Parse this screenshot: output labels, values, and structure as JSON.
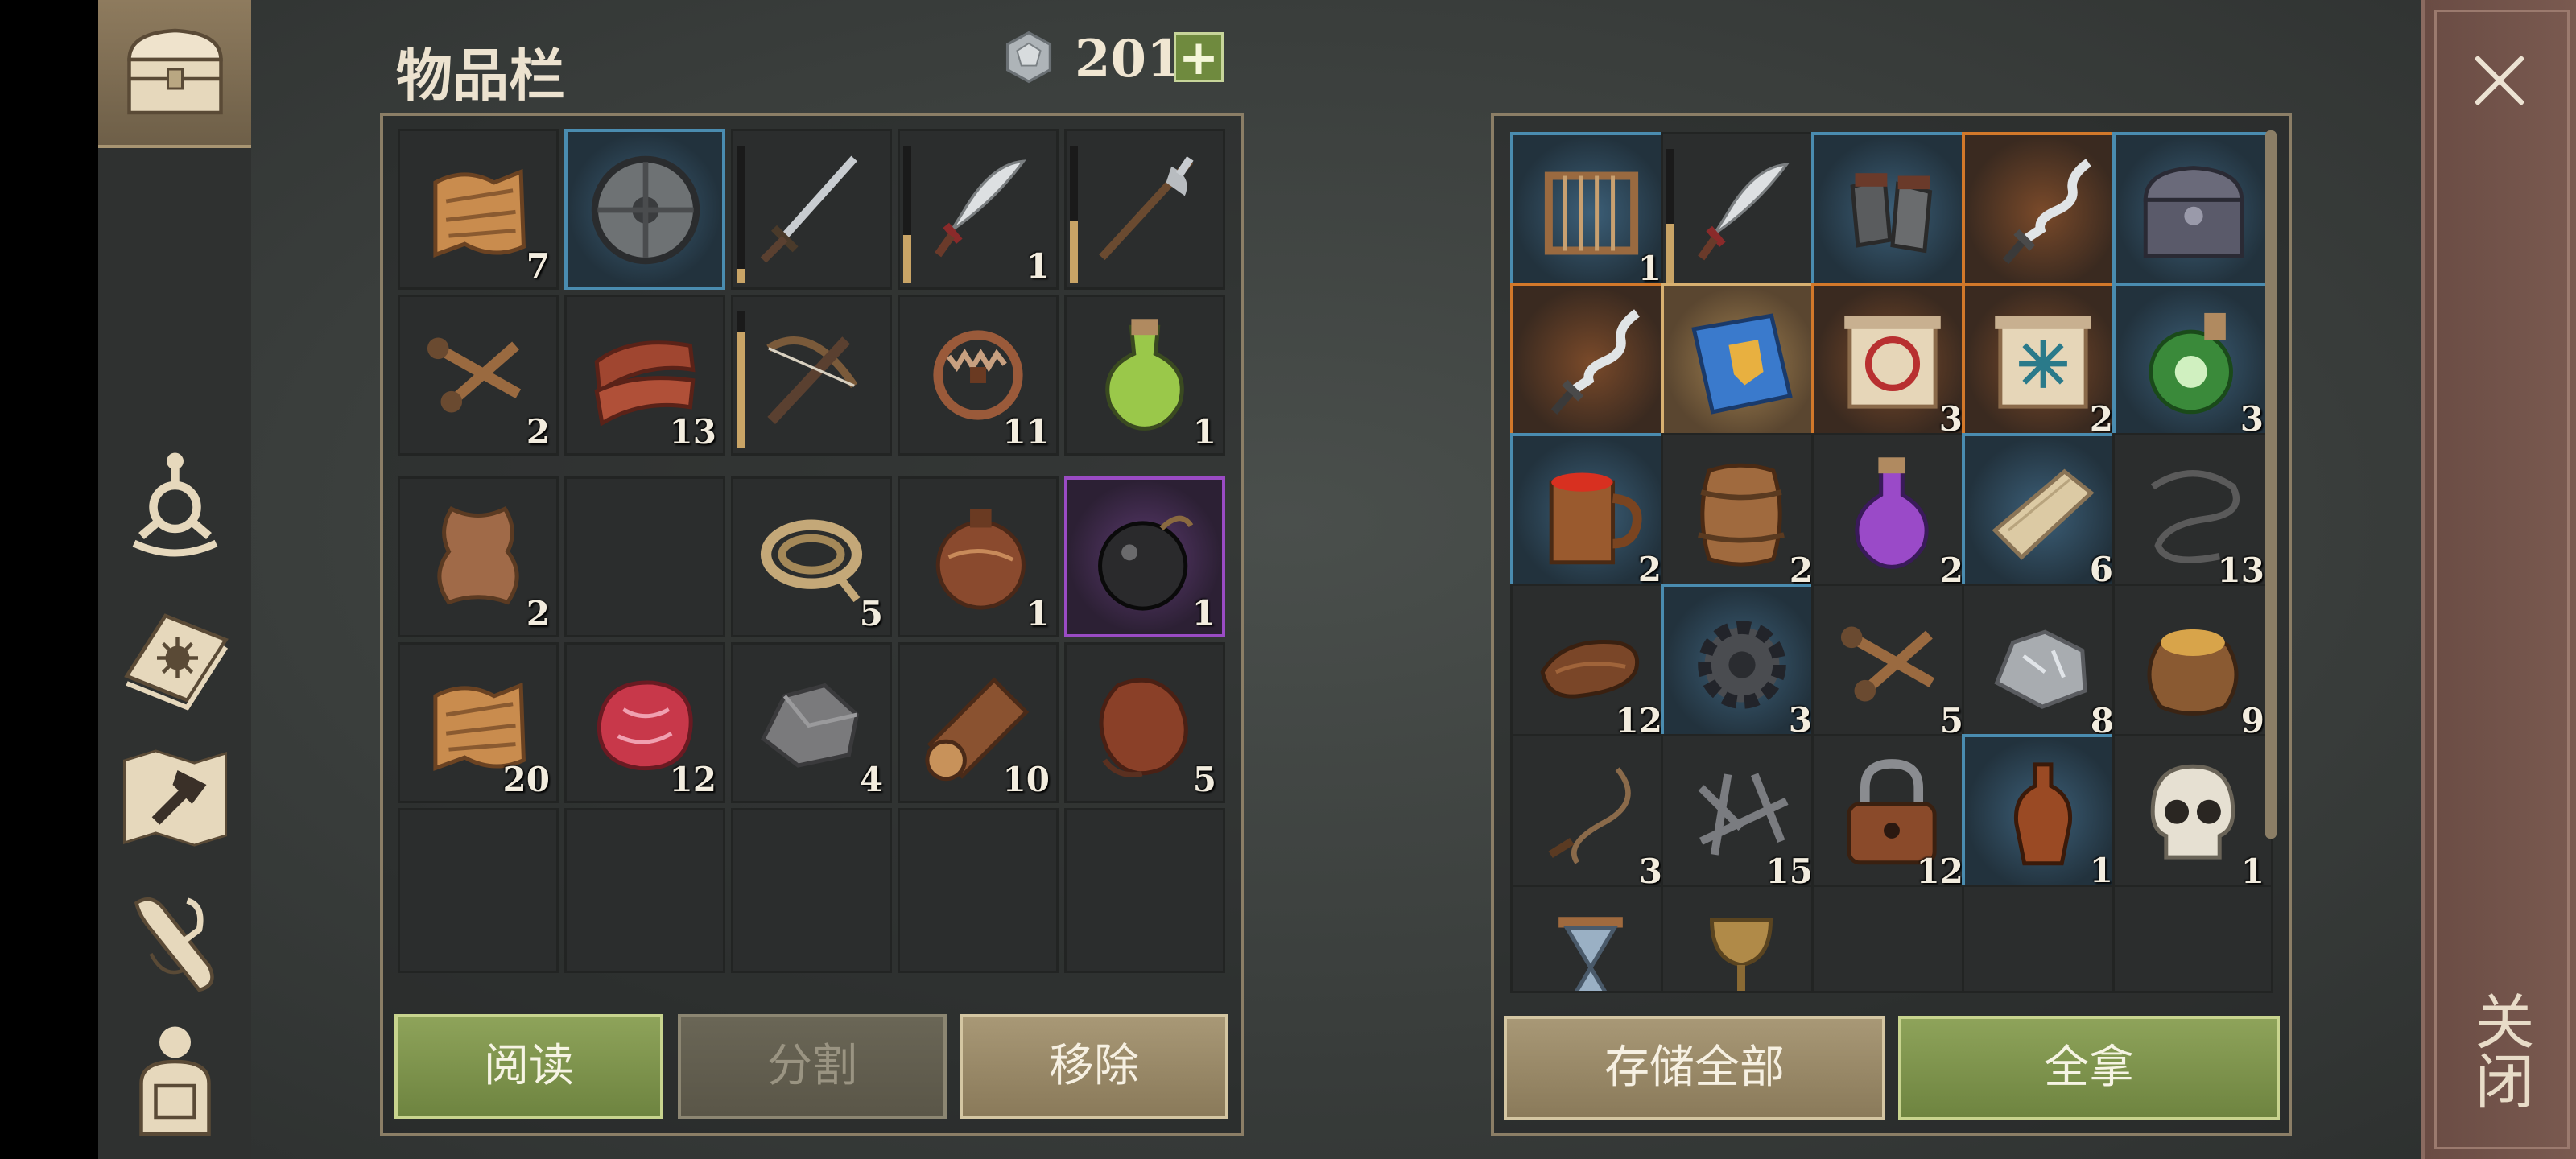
{
  "inventory": {
    "title": "物品栏",
    "currency": {
      "icon": "silver-coin-icon",
      "count": "201",
      "add_label": "+"
    },
    "slots": [
      {
        "icon": "cloth-icon",
        "count": "7"
      },
      {
        "icon": "round-shield-icon",
        "count": "",
        "highlight": "blue"
      },
      {
        "icon": "sword-icon",
        "count": "",
        "durability": 0.1
      },
      {
        "icon": "scimitar-icon",
        "count": "1",
        "durability": 0.35
      },
      {
        "icon": "halberd-icon",
        "count": "",
        "durability": 0.45
      },
      {
        "icon": "nails-icon",
        "count": "2"
      },
      {
        "icon": "raw-meat-strips-icon",
        "count": "13"
      },
      {
        "icon": "crossbow-icon",
        "count": "",
        "durability": 0.85
      },
      {
        "icon": "bear-trap-icon",
        "count": "11"
      },
      {
        "icon": "green-potion-icon",
        "count": "1"
      },
      {
        "icon": "leather-hide-icon",
        "count": "2"
      },
      {
        "icon": "empty-slot",
        "count": ""
      },
      {
        "icon": "rope-icon",
        "count": "5"
      },
      {
        "icon": "leather-flask-icon",
        "count": "1"
      },
      {
        "icon": "bomb-icon",
        "count": "1",
        "highlight": "purple"
      },
      {
        "icon": "cloth-icon",
        "count": "20"
      },
      {
        "icon": "raw-steak-icon",
        "count": "12"
      },
      {
        "icon": "stone-icon",
        "count": "4"
      },
      {
        "icon": "log-icon",
        "count": "10"
      },
      {
        "icon": "water-skin-icon",
        "count": "5"
      },
      {
        "icon": "empty-slot",
        "count": ""
      },
      {
        "icon": "empty-slot",
        "count": ""
      },
      {
        "icon": "empty-slot",
        "count": ""
      },
      {
        "icon": "empty-slot",
        "count": ""
      },
      {
        "icon": "empty-slot",
        "count": ""
      }
    ],
    "buttons": {
      "read": "阅读",
      "split": "分割",
      "remove": "移除"
    }
  },
  "chest": {
    "slots": [
      {
        "icon": "rack-icon",
        "count": "1",
        "highlight": "blue"
      },
      {
        "icon": "scimitar-icon",
        "count": "",
        "durability": 0.45
      },
      {
        "icon": "gauntlets-icon",
        "count": "",
        "highlight": "blue"
      },
      {
        "icon": "wavy-dagger-icon",
        "count": "",
        "highlight": "orange"
      },
      {
        "icon": "iron-chest-icon",
        "count": "",
        "highlight": "blue"
      },
      {
        "icon": "wavy-dagger-icon",
        "count": "",
        "highlight": "orange"
      },
      {
        "icon": "blue-book-icon",
        "count": "",
        "highlight": "gold"
      },
      {
        "icon": "red-scroll-icon",
        "count": "3",
        "highlight": "orange"
      },
      {
        "icon": "blue-scroll-icon",
        "count": "2",
        "highlight": "orange"
      },
      {
        "icon": "poison-potion-icon",
        "count": "3",
        "highlight": "blue"
      },
      {
        "icon": "mug-icon",
        "count": "2",
        "highlight": "blue"
      },
      {
        "icon": "barrel-icon",
        "count": "2"
      },
      {
        "icon": "purple-potion-icon",
        "count": "2"
      },
      {
        "icon": "plank-icon",
        "count": "6",
        "highlight": "blue"
      },
      {
        "icon": "wire-icon",
        "count": "13"
      },
      {
        "icon": "leather-strip-icon",
        "count": "12"
      },
      {
        "icon": "gear-icon",
        "count": "3",
        "highlight": "blue"
      },
      {
        "icon": "nails-icon",
        "count": "5"
      },
      {
        "icon": "iron-ore-icon",
        "count": "8"
      },
      {
        "icon": "grain-sack-icon",
        "count": "9"
      },
      {
        "icon": "whip-icon",
        "count": "3"
      },
      {
        "icon": "scrap-metal-icon",
        "count": "15"
      },
      {
        "icon": "padlock-icon",
        "count": "12"
      },
      {
        "icon": "bottle-icon",
        "count": "1",
        "highlight": "blue"
      },
      {
        "icon": "skull-icon",
        "count": "1"
      },
      {
        "icon": "hourglass-icon",
        "count": ""
      },
      {
        "icon": "goblet-icon",
        "count": ""
      },
      {
        "icon": "empty-slot",
        "count": ""
      },
      {
        "icon": "empty-slot",
        "count": ""
      },
      {
        "icon": "empty-slot",
        "count": ""
      }
    ],
    "buttons": {
      "store_all": "存储全部",
      "take_all": "全拿"
    }
  },
  "close": {
    "label": "关闭",
    "icon": "close-icon"
  },
  "sidebar": {
    "icons": [
      "chest-icon",
      "faction-emblem-icon",
      "sun-book-icon",
      "crafting-map-icon",
      "scroll-quill-icon",
      "character-backpack-icon"
    ]
  }
}
